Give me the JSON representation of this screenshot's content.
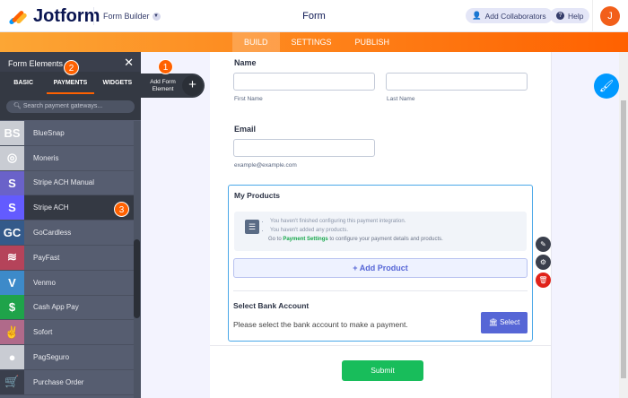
{
  "header": {
    "logo": "Jotform",
    "product": "Form Builder",
    "title": "Form",
    "collab": "Add Collaborators",
    "help": "Help",
    "avatar": "J"
  },
  "tabs": [
    "BUILD",
    "SETTINGS",
    "PUBLISH"
  ],
  "panel": {
    "title": "Form Elements",
    "tabs": [
      "BASIC",
      "PAYMENTS",
      "WIDGETS"
    ],
    "search_placeholder": "Search payment gateways...",
    "items": [
      {
        "label": "BlueSnap",
        "icon": "BS",
        "color": "#c9ccd3"
      },
      {
        "label": "Moneris",
        "icon": "◎",
        "color": "#c9ccd3"
      },
      {
        "label": "Stripe ACH Manual",
        "icon": "S",
        "color": "#6a62c9"
      },
      {
        "label": "Stripe ACH",
        "icon": "S",
        "color": "#635bff"
      },
      {
        "label": "GoCardless",
        "icon": "GC",
        "color": "#345a8a"
      },
      {
        "label": "PayFast",
        "icon": "≋",
        "color": "#b5435a"
      },
      {
        "label": "Venmo",
        "icon": "V",
        "color": "#3d8ac9"
      },
      {
        "label": "Cash App Pay",
        "icon": "$",
        "color": "#1fa34a"
      },
      {
        "label": "Sofort",
        "icon": "✌",
        "color": "#b06a8a"
      },
      {
        "label": "PagSeguro",
        "icon": "●",
        "color": "#c9ccd3"
      },
      {
        "label": "Purchase Order",
        "icon": "🛒",
        "color": "#3a3f4c"
      }
    ]
  },
  "add_element": {
    "line1": "Add Form",
    "line2": "Element",
    "plus": "+"
  },
  "badges": [
    "1",
    "2",
    "3"
  ],
  "form": {
    "name_label": "Name",
    "first": "First Name",
    "last": "Last Name",
    "email_label": "Email",
    "email_sub": "example@example.com",
    "products": {
      "title": "My Products",
      "bullets": [
        "You haven't finished configuring this payment integration.",
        "You haven't added any products."
      ],
      "go_pre": "Go to ",
      "go_link": "Payment Settings",
      "go_post": " to configure your payment details and products.",
      "add": "+ Add Product"
    },
    "bank": {
      "title": "Select Bank Account",
      "text": "Please select the bank account to make a payment.",
      "button": "Select"
    },
    "submit": "Submit"
  }
}
